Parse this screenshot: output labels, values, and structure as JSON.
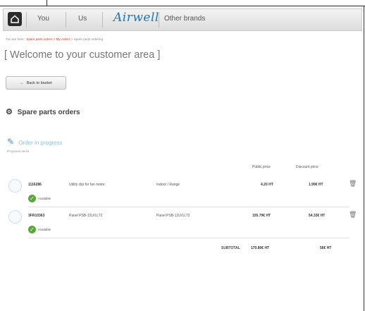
{
  "nav": {
    "items": [
      "You",
      "Us",
      "Other brands"
    ],
    "logo": "Airwell"
  },
  "breadcrumb": {
    "prefix": "You are here :",
    "link": "Spare parts orders > My orders",
    "current": "> Spare parts ordering"
  },
  "page_title": "[ Welcome to your customer area ]",
  "back_button": "Back to basket",
  "section_title": "Spare parts orders",
  "order_link": "Order in progress",
  "order_sub": "Proposed items",
  "columns": {
    "public_price": "Public price",
    "discount_price": "Discount price"
  },
  "rows": [
    {
      "ref": "1116286",
      "desc": "Utility clip for fan motor",
      "model": "Indoor / Range",
      "public_price": "4.20 HT",
      "discount_price": "1.99€ HT",
      "status": "Available"
    },
    {
      "ref": "3FR10363",
      "desc": "Panel PSB-12U/1LT2",
      "model": "Panel PSB-12U/1LT2",
      "public_price": "155.79€ HT",
      "discount_price": "54.33€ HT",
      "status": "Available"
    }
  ],
  "subtotal": {
    "label": "SUBTOTAL",
    "public": "170.80€ HT",
    "discount": "56€ HT"
  }
}
